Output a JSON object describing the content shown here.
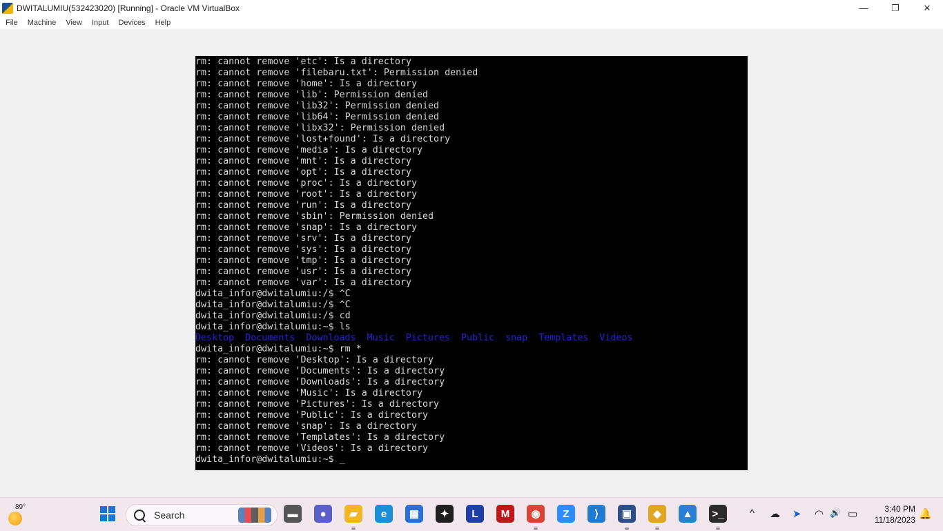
{
  "window": {
    "title": "DWITALUMIU(532423020) [Running] - Oracle VM VirtualBox",
    "controls": {
      "minimize": "—",
      "restore": "❐",
      "close": "✕"
    }
  },
  "menu": [
    "File",
    "Machine",
    "View",
    "Input",
    "Devices",
    "Help"
  ],
  "terminal": {
    "lines_top": [
      "rm: cannot remove 'etc': Is a directory",
      "rm: cannot remove 'filebaru.txt': Permission denied",
      "rm: cannot remove 'home': Is a directory",
      "rm: cannot remove 'lib': Permission denied",
      "rm: cannot remove 'lib32': Permission denied",
      "rm: cannot remove 'lib64': Permission denied",
      "rm: cannot remove 'libx32': Permission denied",
      "rm: cannot remove 'lost+found': Is a directory",
      "rm: cannot remove 'media': Is a directory",
      "rm: cannot remove 'mnt': Is a directory",
      "rm: cannot remove 'opt': Is a directory",
      "rm: cannot remove 'proc': Is a directory",
      "rm: cannot remove 'root': Is a directory",
      "rm: cannot remove 'run': Is a directory",
      "rm: cannot remove 'sbin': Permission denied",
      "rm: cannot remove 'snap': Is a directory",
      "rm: cannot remove 'srv': Is a directory",
      "rm: cannot remove 'sys': Is a directory",
      "rm: cannot remove 'tmp': Is a directory",
      "rm: cannot remove 'usr': Is a directory",
      "rm: cannot remove 'var': Is a directory",
      "dwita_infor@dwitalumiu:/$ ^C",
      "dwita_infor@dwitalumiu:/$ ^C",
      "dwita_infor@dwitalumiu:/$ cd",
      "dwita_infor@dwitalumiu:~$ ls"
    ],
    "ls_output": [
      "Desktop",
      "Documents",
      "Downloads",
      "Music",
      "Pictures",
      "Public",
      "snap",
      "Templates",
      "Videos"
    ],
    "lines_bottom": [
      "dwita_infor@dwitalumiu:~$ rm *",
      "rm: cannot remove 'Desktop': Is a directory",
      "rm: cannot remove 'Documents': Is a directory",
      "rm: cannot remove 'Downloads': Is a directory",
      "rm: cannot remove 'Music': Is a directory",
      "rm: cannot remove 'Pictures': Is a directory",
      "rm: cannot remove 'Public': Is a directory",
      "rm: cannot remove 'snap': Is a directory",
      "rm: cannot remove 'Templates': Is a directory",
      "rm: cannot remove 'Videos': Is a directory"
    ],
    "prompt": "dwita_infor@dwitalumiu:~$ ",
    "cursor": "_",
    "ls_color": "#2424d8"
  },
  "taskbar": {
    "weather_temp": "89°",
    "search_label": "Search",
    "apps": [
      {
        "name": "file-explorer-gray-icon",
        "glyph": "▬",
        "bg": "#555555"
      },
      {
        "name": "meet-chat-icon",
        "glyph": "●",
        "bg": "#5b5fc7"
      },
      {
        "name": "folder-icon",
        "glyph": "▰",
        "bg": "#f2b526"
      },
      {
        "name": "edge-icon",
        "glyph": "e",
        "bg": "#1a8fd8"
      },
      {
        "name": "store-icon",
        "glyph": "▦",
        "bg": "#2a6fd6"
      },
      {
        "name": "dropbox-icon",
        "glyph": "✦",
        "bg": "#1f1f1f"
      },
      {
        "name": "l-app-icon",
        "glyph": "L",
        "bg": "#1f3fa8"
      },
      {
        "name": "mcafee-icon",
        "glyph": "M",
        "bg": "#c01818"
      },
      {
        "name": "chrome-icon",
        "glyph": "◉",
        "bg": "#db4437"
      },
      {
        "name": "zoom-icon",
        "glyph": "Z",
        "bg": "#2d8cff"
      },
      {
        "name": "vscode-icon",
        "glyph": "⟩",
        "bg": "#1f7ad1"
      },
      {
        "name": "virtualbox-icon",
        "glyph": "▣",
        "bg": "#2d4e86"
      },
      {
        "name": "virtualbox-vm-icon",
        "glyph": "◆",
        "bg": "#e0a622"
      },
      {
        "name": "photos-icon",
        "glyph": "▲",
        "bg": "#2b80d6"
      },
      {
        "name": "terminal-icon",
        "glyph": ">_",
        "bg": "#2b2b2b"
      }
    ],
    "tray": {
      "chevron": "^",
      "cloud": "☁",
      "location": "➤",
      "wifi": "◠",
      "volume": "🔊",
      "battery": "▭"
    },
    "time": "3:40 PM",
    "date": "11/18/2023",
    "bell": "🔔"
  }
}
